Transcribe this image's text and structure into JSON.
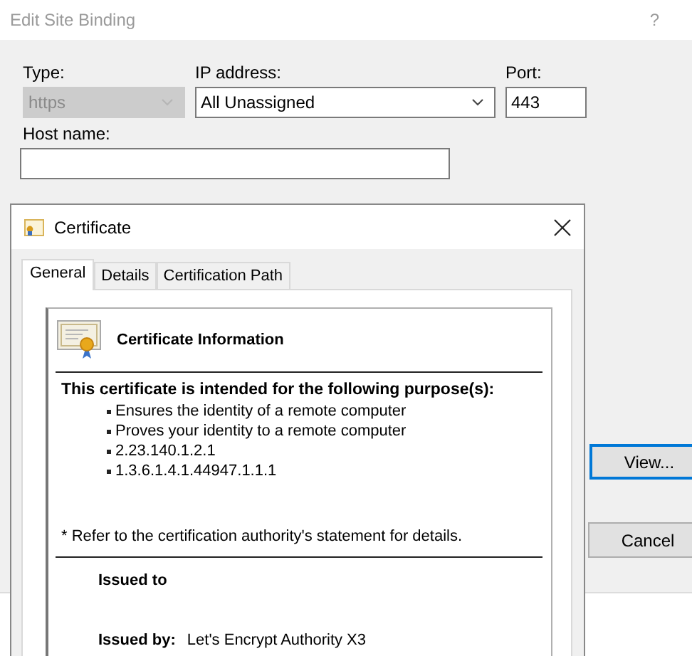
{
  "window": {
    "title": "Edit Site Binding",
    "help": "?"
  },
  "fields": {
    "type": {
      "label": "Type:",
      "value": "https",
      "disabled": true
    },
    "ip_address": {
      "label": "IP address:",
      "value": "All Unassigned",
      "disabled": false
    },
    "port": {
      "label": "Port:",
      "value": "443"
    },
    "host_name": {
      "label": "Host name:"
    }
  },
  "buttons": [
    {
      "label": "View...",
      "focused": true
    },
    {
      "label": "Cancel",
      "focused": false
    }
  ],
  "certificate": {
    "title": "Certificate",
    "tabs": [
      {
        "label": "General",
        "selected": true
      },
      {
        "label": "Details",
        "selected": false
      },
      {
        "label": "Certification Path",
        "selected": false
      }
    ],
    "heading": "Certificate Information",
    "purpose_heading": "This certificate is intended for the following purpose(s):",
    "purposes": [
      "Ensures the identity of a remote computer",
      "Proves your identity to a remote computer",
      "2.23.140.1.2.1",
      "1.3.6.1.4.1.44947.1.1.1"
    ],
    "note": "* Refer to the certification authority's statement for details.",
    "issued_to_label": "Issued to",
    "issued_by_label": "Issued by:",
    "issued_by_value": "Let's Encrypt Authority X3"
  }
}
